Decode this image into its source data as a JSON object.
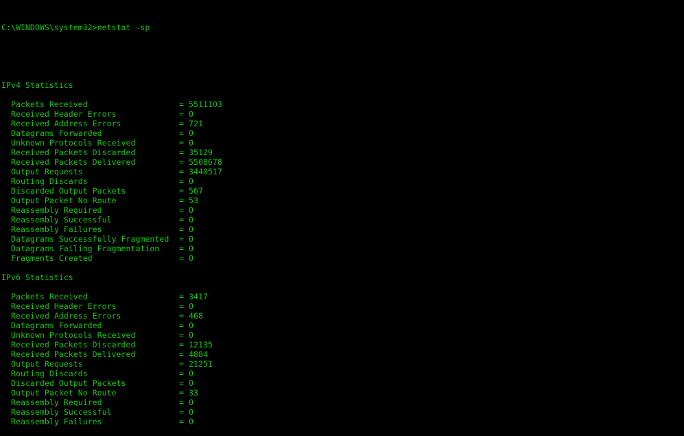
{
  "prompt": "C:\\WINDOWS\\system32>netstat -sp",
  "sections": [
    {
      "title": "IPv4 Statistics",
      "stats": [
        {
          "label": "Packets Received",
          "value": "5511103"
        },
        {
          "label": "Received Header Errors",
          "value": "0"
        },
        {
          "label": "Received Address Errors",
          "value": "721"
        },
        {
          "label": "Datagrams Forwarded",
          "value": "0"
        },
        {
          "label": "Unknown Protocols Received",
          "value": "0"
        },
        {
          "label": "Received Packets Discarded",
          "value": "35129"
        },
        {
          "label": "Received Packets Delivered",
          "value": "5508678"
        },
        {
          "label": "Output Requests",
          "value": "3440517"
        },
        {
          "label": "Routing Discards",
          "value": "0"
        },
        {
          "label": "Discarded Output Packets",
          "value": "567"
        },
        {
          "label": "Output Packet No Route",
          "value": "53"
        },
        {
          "label": "Reassembly Required",
          "value": "0"
        },
        {
          "label": "Reassembly Successful",
          "value": "0"
        },
        {
          "label": "Reassembly Failures",
          "value": "0"
        },
        {
          "label": "Datagrams Successfully Fragmented",
          "value": "0"
        },
        {
          "label": "Datagrams Failing Fragmentation",
          "value": "0"
        },
        {
          "label": "Fragments Created",
          "value": "0"
        }
      ]
    },
    {
      "title": "IPv6 Statistics",
      "stats": [
        {
          "label": "Packets Received",
          "value": "3417"
        },
        {
          "label": "Received Header Errors",
          "value": "0"
        },
        {
          "label": "Received Address Errors",
          "value": "468"
        },
        {
          "label": "Datagrams Forwarded",
          "value": "0"
        },
        {
          "label": "Unknown Protocols Received",
          "value": "0"
        },
        {
          "label": "Received Packets Discarded",
          "value": "12135"
        },
        {
          "label": "Received Packets Delivered",
          "value": "4884"
        },
        {
          "label": "Output Requests",
          "value": "21251"
        },
        {
          "label": "Routing Discards",
          "value": "0"
        },
        {
          "label": "Discarded Output Packets",
          "value": "0"
        },
        {
          "label": "Output Packet No Route",
          "value": "33"
        },
        {
          "label": "Reassembly Required",
          "value": "0"
        },
        {
          "label": "Reassembly Successful",
          "value": "0"
        },
        {
          "label": "Reassembly Failures",
          "value": "0"
        }
      ]
    }
  ],
  "colors": {
    "text": "#16c60c",
    "background": "#000000"
  }
}
